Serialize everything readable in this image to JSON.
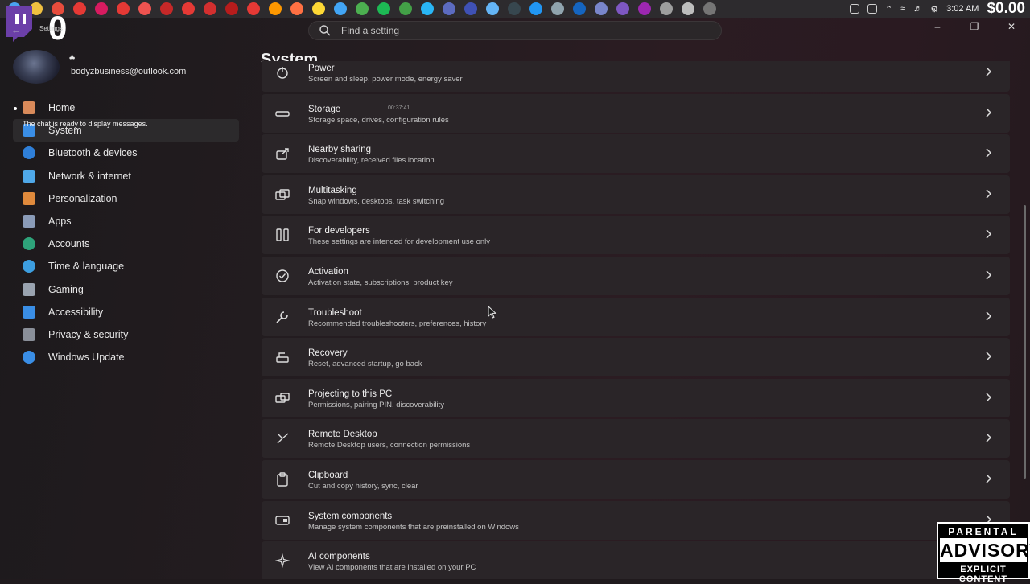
{
  "overlay": {
    "counter": "0",
    "money": "$0.00",
    "chat_message": "The chat is ready to display messages.",
    "timestamp": "00:37:41"
  },
  "taskbar": {
    "clock": "3:02 AM",
    "icons": [
      {
        "name": "windows-start-icon",
        "color": "#4aa3f0"
      },
      {
        "name": "file-explorer-icon",
        "color": "#f0c040"
      },
      {
        "name": "chrome-icon",
        "color": "#e74c3c"
      },
      {
        "name": "app-icon-red-1",
        "color": "#e53935"
      },
      {
        "name": "app-icon-red-2",
        "color": "#d81b60"
      },
      {
        "name": "app-icon-red-3",
        "color": "#e53935"
      },
      {
        "name": "app-icon-red-4",
        "color": "#ef5350"
      },
      {
        "name": "app-icon-red-5",
        "color": "#c62828"
      },
      {
        "name": "app-icon-red-6",
        "color": "#e53935"
      },
      {
        "name": "app-icon-red-7",
        "color": "#d32f2f"
      },
      {
        "name": "app-icon-red-8",
        "color": "#b71c1c"
      },
      {
        "name": "app-icon-red-9",
        "color": "#e53935"
      },
      {
        "name": "app-icon-orange",
        "color": "#ff9800"
      },
      {
        "name": "firefox-icon",
        "color": "#ff7043"
      },
      {
        "name": "app-icon-yellow",
        "color": "#fdd835"
      },
      {
        "name": "app-icon-blue-1",
        "color": "#42a5f5"
      },
      {
        "name": "chrome-icon-2",
        "color": "#4caf50"
      },
      {
        "name": "spotify-icon",
        "color": "#1db954"
      },
      {
        "name": "app-icon-green",
        "color": "#43a047"
      },
      {
        "name": "edge-icon",
        "color": "#29b6f6"
      },
      {
        "name": "app-icon-blue-2",
        "color": "#5c6bc0"
      },
      {
        "name": "app-icon-blue-3",
        "color": "#3f51b5"
      },
      {
        "name": "app-icon-blue-4",
        "color": "#64b5f6"
      },
      {
        "name": "app-icon-dark",
        "color": "#37474f"
      },
      {
        "name": "app-icon-blue-5",
        "color": "#2196f3"
      },
      {
        "name": "steam-icon",
        "color": "#90a4ae"
      },
      {
        "name": "photoshop-icon",
        "color": "#1565c0"
      },
      {
        "name": "discord-icon",
        "color": "#7986cb"
      },
      {
        "name": "discord-icon-2",
        "color": "#7e57c2"
      },
      {
        "name": "app-icon-purple",
        "color": "#9c27b0"
      },
      {
        "name": "app-icon-gray-1",
        "color": "#9e9e9e"
      },
      {
        "name": "app-icon-gray-2",
        "color": "#bdbdbd"
      },
      {
        "name": "app-icon-gray-3",
        "color": "#757575"
      }
    ]
  },
  "search": {
    "placeholder": "Find a setting"
  },
  "account": {
    "username": "♣",
    "email": "bodyzbusiness@outlook.com",
    "back_label": "Settings"
  },
  "sidebar": {
    "items": [
      {
        "label": "Home",
        "icon": "home-icon",
        "color": "#d98a5a"
      },
      {
        "label": "System",
        "icon": "system-icon",
        "color": "#3a8ee6"
      },
      {
        "label": "Bluetooth & devices",
        "icon": "bluetooth-icon",
        "color": "#2f7fd8"
      },
      {
        "label": "Network & internet",
        "icon": "wifi-icon",
        "color": "#4fa8e8"
      },
      {
        "label": "Personalization",
        "icon": "brush-icon",
        "color": "#e08a3c"
      },
      {
        "label": "Apps",
        "icon": "apps-icon",
        "color": "#8a9bb8"
      },
      {
        "label": "Accounts",
        "icon": "accounts-icon",
        "color": "#2ea37a"
      },
      {
        "label": "Time & language",
        "icon": "globe-icon",
        "color": "#3d9ee0"
      },
      {
        "label": "Gaming",
        "icon": "gamepad-icon",
        "color": "#9aa3b0"
      },
      {
        "label": "Accessibility",
        "icon": "accessibility-icon",
        "color": "#3a8ee6"
      },
      {
        "label": "Privacy & security",
        "icon": "shield-icon",
        "color": "#8a8f99"
      },
      {
        "label": "Windows Update",
        "icon": "update-icon",
        "color": "#3a8ee6"
      }
    ]
  },
  "main": {
    "title": "System",
    "rows": [
      {
        "title": "Power",
        "subtitle": "Screen and sleep, power mode, energy saver",
        "icon": "power-icon"
      },
      {
        "title": "Storage",
        "subtitle": "Storage space, drives, configuration rules",
        "icon": "storage-icon"
      },
      {
        "title": "Nearby sharing",
        "subtitle": "Discoverability, received files location",
        "icon": "share-icon"
      },
      {
        "title": "Multitasking",
        "subtitle": "Snap windows, desktops, task switching",
        "icon": "multitasking-icon"
      },
      {
        "title": "For developers",
        "subtitle": "These settings are intended for development use only",
        "icon": "developer-icon"
      },
      {
        "title": "Activation",
        "subtitle": "Activation state, subscriptions, product key",
        "icon": "activation-icon"
      },
      {
        "title": "Troubleshoot",
        "subtitle": "Recommended troubleshooters, preferences, history",
        "icon": "wrench-icon"
      },
      {
        "title": "Recovery",
        "subtitle": "Reset, advanced startup, go back",
        "icon": "recovery-icon"
      },
      {
        "title": "Projecting to this PC",
        "subtitle": "Permissions, pairing PIN, discoverability",
        "icon": "projecting-icon"
      },
      {
        "title": "Remote Desktop",
        "subtitle": "Remote Desktop users, connection permissions",
        "icon": "remote-desktop-icon"
      },
      {
        "title": "Clipboard",
        "subtitle": "Cut and copy history, sync, clear",
        "icon": "clipboard-icon"
      },
      {
        "title": "System components",
        "subtitle": "Manage system components that are preinstalled on Windows",
        "icon": "components-icon"
      },
      {
        "title": "AI components",
        "subtitle": "View AI components that are installed on your PC",
        "icon": "ai-icon"
      }
    ]
  },
  "advisory": {
    "line1": "PARENTAL",
    "line2": "ADVISORY",
    "line3": "EXPLICIT CONTENT"
  }
}
